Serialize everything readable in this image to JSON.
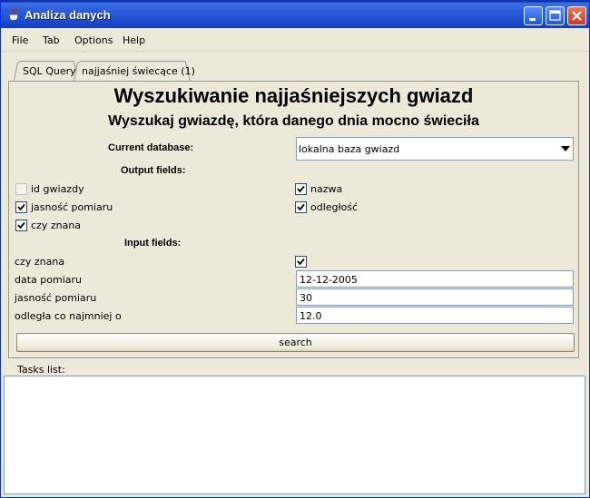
{
  "window": {
    "title": "Analiza danych"
  },
  "menu": [
    "File",
    "Tab",
    "Options",
    "Help"
  ],
  "tabs": [
    {
      "label": "SQL Query"
    },
    {
      "label": "najjaśniej świecące (1)"
    }
  ],
  "panel": {
    "heading": "Wyszukiwanie najjaśniejszych gwiazd",
    "subheading": "Wyszukaj gwiazdę, która danego dnia mocno świeciła",
    "database_label": "Current database:",
    "database_value": "lokalna baza gwiazd",
    "output_fields_label": "Output fields:",
    "output_fields": [
      {
        "label": "id gwiazdy",
        "checked": false
      },
      {
        "label": "nazwa",
        "checked": true
      },
      {
        "label": "jasność pomiaru",
        "checked": true
      },
      {
        "label": "odległość",
        "checked": true
      },
      {
        "label": "czy znana",
        "checked": true
      }
    ],
    "input_fields_label": "Input fields:",
    "input_fields": [
      {
        "label": "czy znana",
        "value": "",
        "type": "checkbox",
        "checked": true
      },
      {
        "label": "data pomiaru",
        "value": "12-12-2005",
        "type": "text"
      },
      {
        "label": "jasność pomiaru",
        "value": "30",
        "type": "text"
      },
      {
        "label": "odległa co najmniej o",
        "value": "12.0",
        "type": "text"
      }
    ],
    "search_label": "search"
  },
  "tasks": {
    "label": "Tasks list:"
  },
  "colors": {
    "title_bar": "#2a5bd7",
    "window_bg": "#ece9d8",
    "close_button": "#c83a1a",
    "check": "#21a121"
  }
}
